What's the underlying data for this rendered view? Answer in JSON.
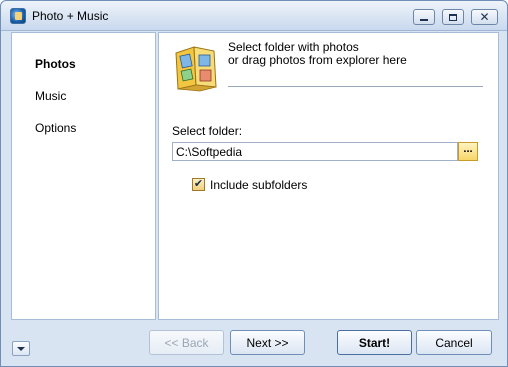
{
  "window": {
    "title": "Photo + Music"
  },
  "titlebar": {
    "minimize_icon": "minimize-icon",
    "maximize_icon": "maximize-icon",
    "close_icon": "close-icon",
    "close_glyph": "✕"
  },
  "sidebar": {
    "items": [
      {
        "label": "Photos",
        "active": true
      },
      {
        "label": "Music",
        "active": false
      },
      {
        "label": "Options",
        "active": false
      }
    ]
  },
  "main": {
    "header": {
      "line1": "Select folder with photos",
      "line2": "or drag photos from explorer here",
      "icon": "photo-album-icon"
    },
    "folder": {
      "label": "Select folder:",
      "value": "C:\\Softpedia",
      "browse_label": "..."
    },
    "include_subfolders": {
      "label": "Include subfolders",
      "checked": true,
      "check_glyph": "✔"
    }
  },
  "footer": {
    "back_label": "<< Back",
    "next_label": "Next >>",
    "start_label": "Start!",
    "cancel_label": "Cancel",
    "back_enabled": false
  },
  "colors": {
    "frame": "#d8e4f2",
    "border": "#a7bcd9",
    "accent_yellow": "#f7d66a"
  }
}
